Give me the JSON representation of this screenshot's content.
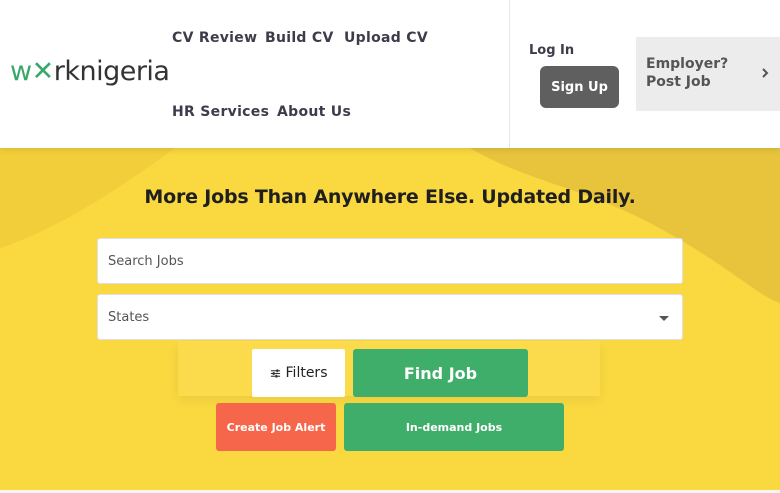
{
  "brand": {
    "logo_parts": [
      "w",
      "o",
      "rk",
      "nigeria"
    ],
    "logo_text": "worknigeria",
    "primary_green": "#3fae6a",
    "hero_yellow": "#f9d840",
    "alert_orange": "#f6664a"
  },
  "nav": {
    "links": [
      "CV Review",
      "Build CV",
      "Upload CV",
      "HR Services",
      "About Us"
    ],
    "login_label": "Log In",
    "signup_label": "Sign Up",
    "employer_label_line1": "Employer?",
    "employer_label_line2": "Post Job",
    "employer_icon": "chevron-right-icon"
  },
  "hero": {
    "headline": "More Jobs Than Anywhere Else. Updated Daily.",
    "search_placeholder": "Search Jobs",
    "states_placeholder": "States",
    "filters_label": "Filters",
    "filters_icon": "sliders-icon",
    "find_label": "Find Job",
    "alert_label": "Create Job Alert",
    "demand_label": "In-demand Jobs"
  }
}
